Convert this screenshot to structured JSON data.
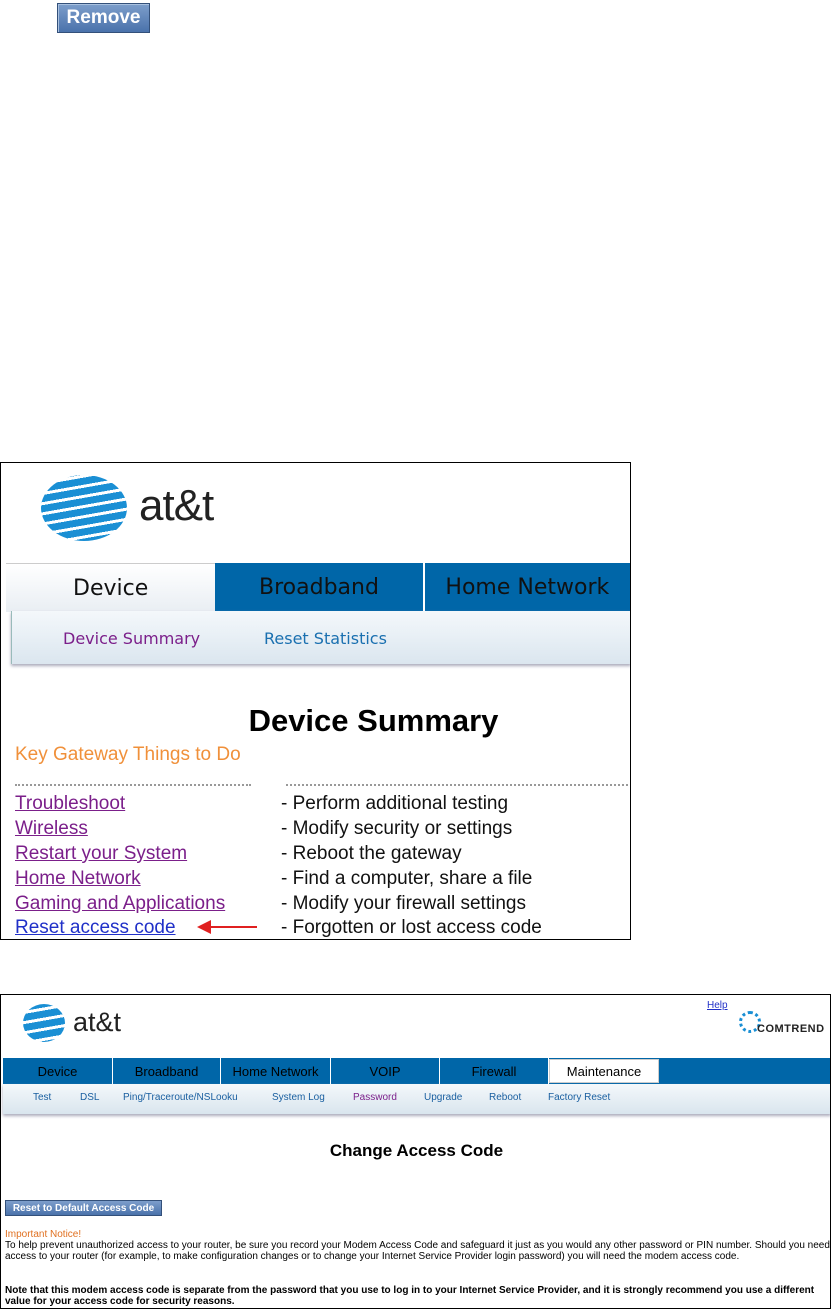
{
  "top": {
    "remove_label": "Remove"
  },
  "panel1": {
    "logo_text": "at&t",
    "tabs": [
      "Device",
      "Broadband",
      "Home Network"
    ],
    "subnav": [
      "Device Summary",
      "Reset Statistics"
    ],
    "title": "Device Summary",
    "key_heading": "Key Gateway Things to Do",
    "rows": [
      {
        "link": "Troubleshoot",
        "desc": "- Perform additional testing"
      },
      {
        "link": "Wireless",
        "desc": "- Modify security or settings"
      },
      {
        "link": "Restart your System",
        "desc": "- Reboot the gateway"
      },
      {
        "link": "Home Network",
        "desc": "- Find a computer, share a file"
      },
      {
        "link": "Gaming and Applications",
        "desc": "- Modify your firewall settings"
      },
      {
        "link": "Reset access code",
        "desc": "- Forgotten or lost access code"
      }
    ]
  },
  "panel2": {
    "logo_text": "at&t",
    "help": "Help",
    "brand": "COMTREND",
    "tabs": [
      "Device",
      "Broadband",
      "Home Network",
      "VOIP",
      "Firewall",
      "Maintenance"
    ],
    "subnav": [
      "Test",
      "DSL",
      "Ping/Traceroute/NSLooku",
      "System Log",
      "Password",
      "Upgrade",
      "Reboot",
      "Factory Reset"
    ],
    "title": "Change Access Code",
    "reset_button": "Reset to Default Access Code",
    "notice_heading": "Important Notice!",
    "notice_text": "To help prevent unauthorized access to your router, be sure you record your Modem Access Code and safeguard it just as you would any other password or PIN number. Should you need access to your router (for example, to make configuration changes or to change your Internet Service Provider login password) you will need the modem access code.",
    "notice_bold": "Note that this modem access code is separate from the password that you use to log in to your Internet Service Provider, and it is strongly recommend you use a different value for your access code for security reasons."
  }
}
